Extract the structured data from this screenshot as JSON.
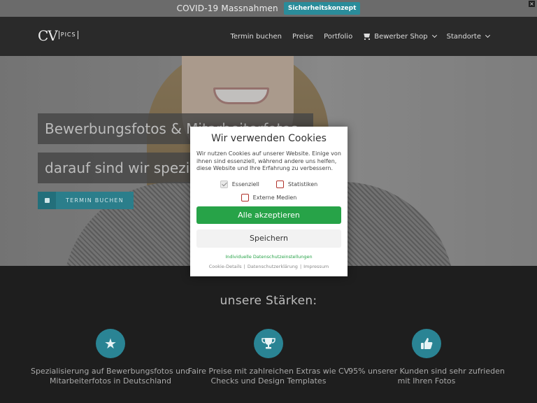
{
  "topbar": {
    "notice": "COVID-19 Massnahmen",
    "button_label": "Sicherheitskonzept",
    "close_label": "×"
  },
  "header": {
    "logo_cv": "CV",
    "logo_pics": "PICS",
    "nav": [
      {
        "label": "Termin buchen"
      },
      {
        "label": "Preise"
      },
      {
        "label": "Portfolio"
      },
      {
        "label": "Bewerber Shop",
        "icon": "cart-icon",
        "dropdown": true
      },
      {
        "label": "Standorte",
        "dropdown": true
      }
    ]
  },
  "hero": {
    "headline_1": "Bewerbungsfotos & Mitarbeiterfotos",
    "headline_2": "darauf sind wir spezialisiert",
    "cta_label": "TERMIN BUCHEN",
    "cta_icon": "calendar-icon"
  },
  "strengths": {
    "title": "unsere Stärken:",
    "items": [
      {
        "icon": "star-icon",
        "text": "Spezialisierung auf Bewerbungsfotos und Mitarbeiterfotos in Deutschland"
      },
      {
        "icon": "trophy-icon",
        "text": "Faire Preise mit zahlreichen Extras wie CV Checks und Design Templates"
      },
      {
        "icon": "thumbs-up-icon",
        "text": "95% unserer Kunden sind sehr zufrieden mit Ihren Fotos"
      }
    ]
  },
  "cookie_modal": {
    "title": "Wir verwenden Cookies",
    "description": "Wir nutzen Cookies auf unserer Website. Einige von ihnen sind essenziell, während andere uns helfen, diese Website und Ihre Erfahrung zu verbessern.",
    "options": {
      "essential": {
        "label": "Essenziell",
        "checked": true
      },
      "statistics": {
        "label": "Statistiken",
        "checked": false
      },
      "external_media": {
        "label": "Externe Medien",
        "checked": false
      }
    },
    "accept_all_label": "Alle akzeptieren",
    "save_label": "Speichern",
    "individual_label": "Individuelle Datenschutzeinstellungen",
    "links": {
      "cookie_details": "Cookie-Details",
      "privacy": "Datenschutzerklärung",
      "imprint": "Impressum",
      "separator": "|"
    }
  },
  "colors": {
    "accent_teal": "#2a8494",
    "accept_green": "#27a348",
    "checkbox_red": "#b0312a"
  }
}
